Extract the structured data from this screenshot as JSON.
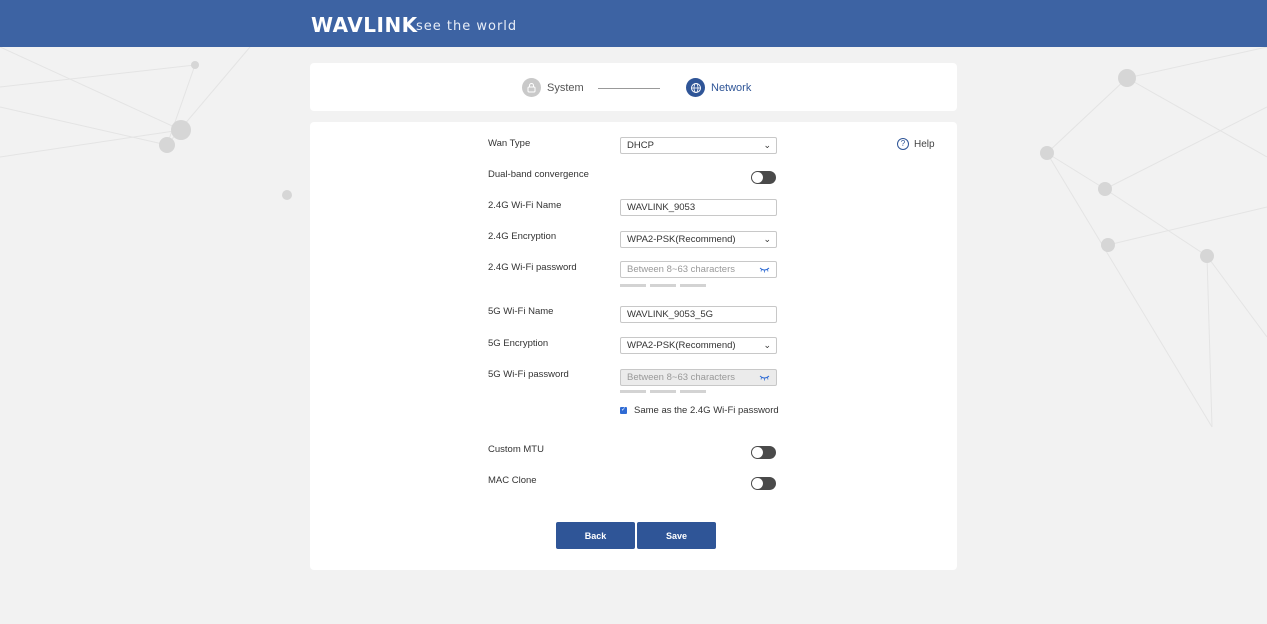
{
  "header": {
    "logo": "WAVLINK",
    "tagline": "see the world"
  },
  "stepper": {
    "steps": [
      {
        "label": "System",
        "icon": "lock-icon"
      },
      {
        "label": "Network",
        "icon": "globe-icon"
      }
    ]
  },
  "form": {
    "help_label": "Help",
    "wan_type": {
      "label": "Wan Type",
      "value": "DHCP"
    },
    "dual_band": {
      "label": "Dual-band convergence",
      "enabled": false
    },
    "wifi_24_name": {
      "label": "2.4G Wi-Fi Name",
      "value": "WAVLINK_9053"
    },
    "wifi_24_encryption": {
      "label": "2.4G Encryption",
      "value": "WPA2-PSK(Recommend)"
    },
    "wifi_24_password": {
      "label": "2.4G Wi-Fi password",
      "placeholder": "Between 8~63 characters"
    },
    "wifi_5_name": {
      "label": "5G Wi-Fi Name",
      "value": "WAVLINK_9053_5G"
    },
    "wifi_5_encryption": {
      "label": "5G Encryption",
      "value": "WPA2-PSK(Recommend)"
    },
    "wifi_5_password": {
      "label": "5G Wi-Fi password",
      "placeholder": "Between 8~63 characters"
    },
    "same_password": {
      "label": "Same as the 2.4G Wi-Fi password",
      "checked": true
    },
    "custom_mtu": {
      "label": "Custom MTU",
      "enabled": false
    },
    "mac_clone": {
      "label": "MAC Clone",
      "enabled": false
    }
  },
  "buttons": {
    "back": "Back",
    "save": "Save"
  },
  "colors": {
    "header": "#3d63a3",
    "primary": "#2f5597",
    "background": "#f2f2f2"
  }
}
